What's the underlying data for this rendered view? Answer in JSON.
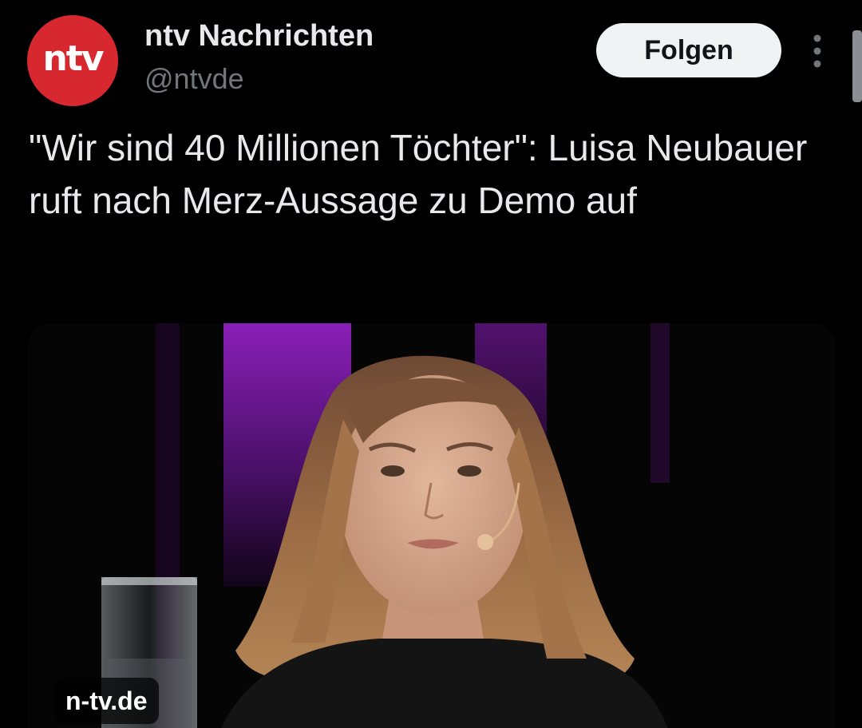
{
  "account": {
    "avatar_text": "ntv",
    "display_name": "ntv Nachrichten",
    "handle": "@ntvde",
    "brand_color": "#d7282f"
  },
  "actions": {
    "follow_label": "Folgen",
    "more_icon": "more-vertical-icon"
  },
  "post": {
    "text": "\"Wir sind 40 Millionen Töchter\": Luisa Neubauer ruft nach Merz-Aussage zu Demo auf"
  },
  "media": {
    "source_label": "n-tv.de"
  }
}
